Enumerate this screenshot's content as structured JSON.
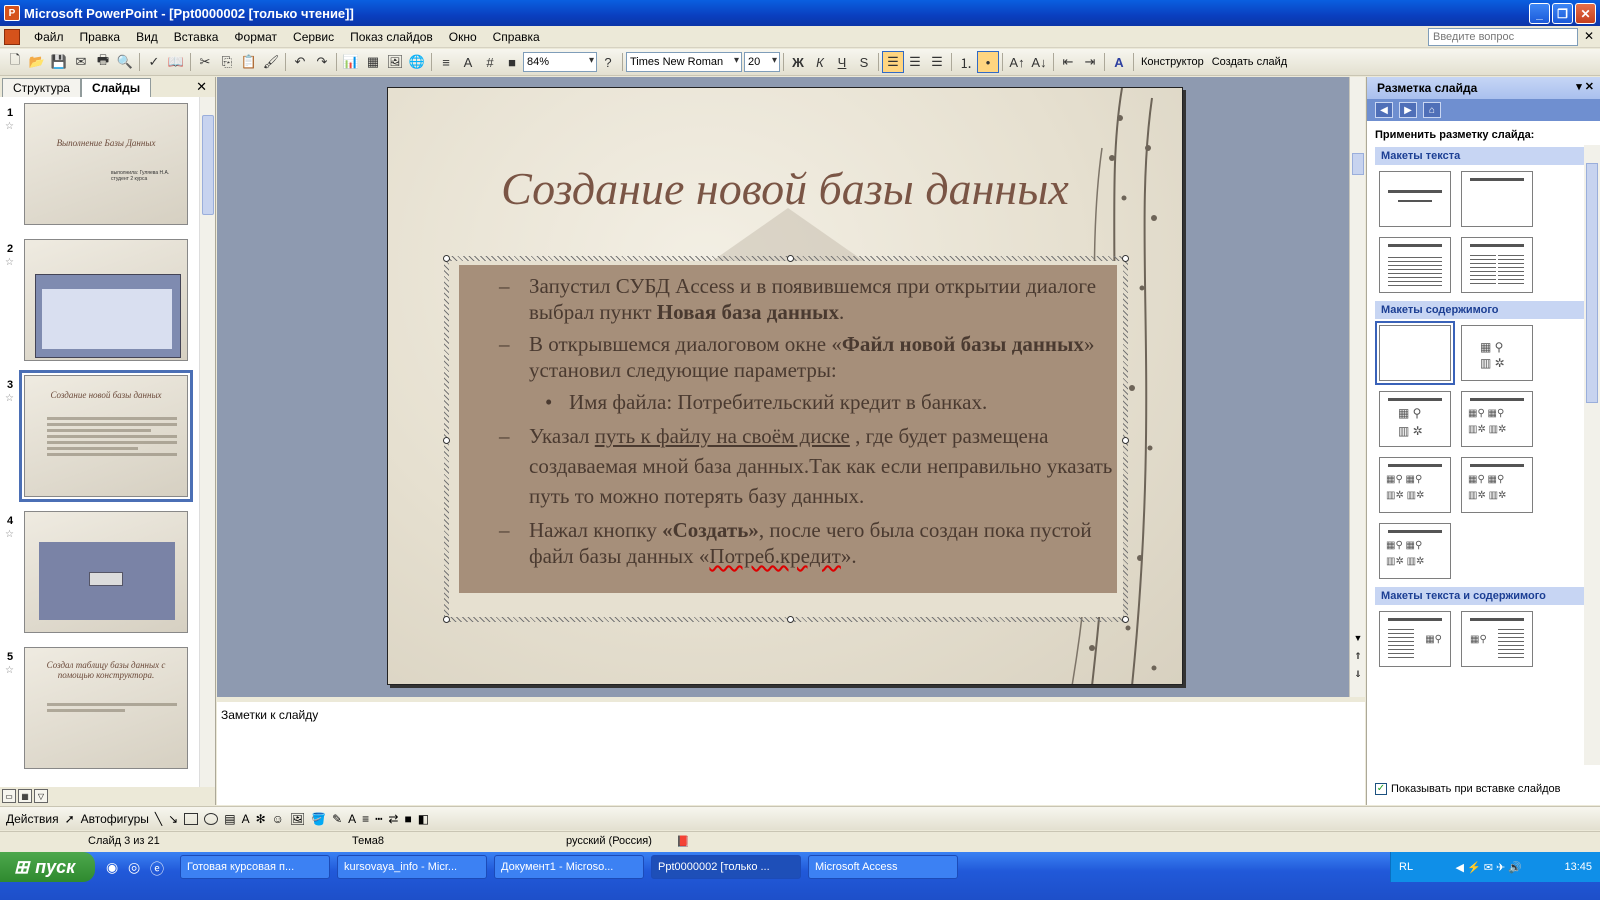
{
  "window": {
    "title": "Microsoft PowerPoint - [Ppt0000002 [только чтение]]",
    "minimize": "_",
    "restore": "❐",
    "close": "✕"
  },
  "menu": {
    "items": [
      "Файл",
      "Правка",
      "Вид",
      "Вставка",
      "Формат",
      "Сервис",
      "Показ слайдов",
      "Окно",
      "Справка"
    ],
    "help_placeholder": "Введите вопрос",
    "close": "✕"
  },
  "toolbar": {
    "zoom": "84%",
    "font": "Times New Roman",
    "size": "20",
    "bold": "Ж",
    "italic": "К",
    "underline": "Ч",
    "shadow": "S",
    "designer": "Конструктор",
    "new_slide": "Создать слайд"
  },
  "left_pane": {
    "tabs": [
      "Структура",
      "Слайды"
    ],
    "close": "✕",
    "slides": [
      {
        "num": "1",
        "title": "Выполнение Базы Данных",
        "sub": "выполнила: Гуляева Н.А. студент 2 курса"
      },
      {
        "num": "2"
      },
      {
        "num": "3",
        "title": "Создание новой базы данных"
      },
      {
        "num": "4"
      },
      {
        "num": "5",
        "title": "Создал таблицу базы данных с помощью конструктора."
      }
    ]
  },
  "slide": {
    "title": "Создание новой базы данных",
    "b1_a": "Запустил СУБД Access и в появившемся при открытии диалоге выбрал пункт ",
    "b1_b": "Новая база данных",
    "b1_c": ".",
    "b2_a": "В открывшемся диалоговом окне «",
    "b2_b": "Файл новой базы данных",
    "b2_c": "» установил следующие параметры:",
    "s1": "Имя файла: Потребительский кредит в банках.",
    "b3_a": " Указал ",
    "b3_b": "путь к файлу на своём диске",
    "b3_c": " , где будет размещена создаваемая мной база данных.Так как если неправильно указать путь то можно потерять базу данных.",
    "b4_a": "Нажал кнопку ",
    "b4_b": "«Создать»",
    "b4_c": ", после чего была создан пока пустой файл базы данных «",
    "b4_d": "Потреб.кредит",
    "b4_e": "»."
  },
  "notes": {
    "label": "Заметки к слайду"
  },
  "task_pane": {
    "title": "Разметка слайда",
    "apply": "Применить разметку слайда:",
    "sec_text": "Макеты текста",
    "sec_content": "Макеты содержимого",
    "sec_text_content": "Макеты текста и содержимого",
    "show_on_insert": "Показывать при вставке слайдов"
  },
  "drawbar": {
    "actions": "Действия",
    "autoshapes": "Автофигуры"
  },
  "status": {
    "slide": "Слайд 3 из 21",
    "theme": "Тема8",
    "language": "русский (Россия)"
  },
  "taskbar": {
    "start": "пуск",
    "tasks": [
      "Готовая курсовая п...",
      "kursovaya_info - Micr...",
      "Документ1 - Microso...",
      "Ppt0000002 [только ...",
      "Microsoft Access"
    ],
    "lang": "RL",
    "time": "13:45"
  }
}
